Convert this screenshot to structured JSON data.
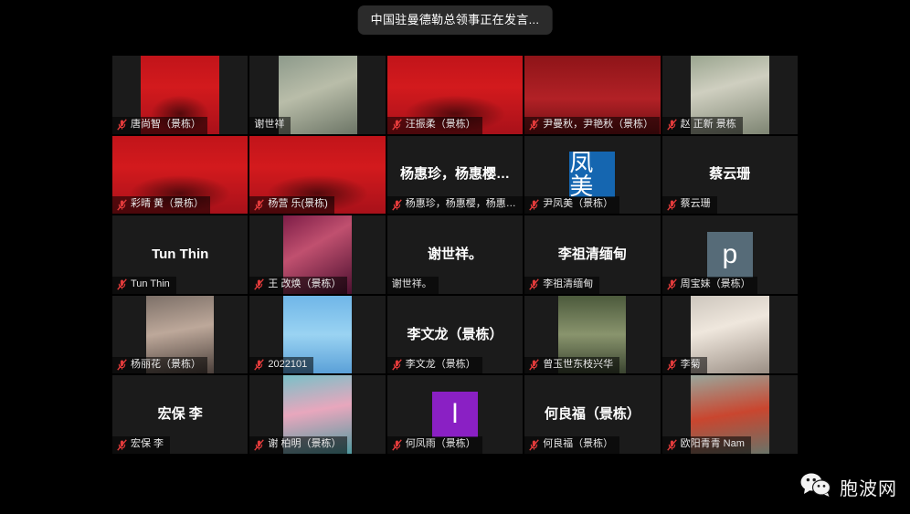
{
  "banner": {
    "speaking_text": "中国驻曼德勒总领事正在发言..."
  },
  "watermark": {
    "icon": "wechat-icon",
    "text": "胞波网"
  },
  "icons": {
    "mic_muted": "mic-muted-icon"
  },
  "gallery": {
    "columns": 5,
    "rows": 5,
    "tiles": [
      {
        "label": "唐尚智（景栋）",
        "muted": true,
        "kind": "photo",
        "style": "bg-red-banner",
        "photo_class": "photo"
      },
      {
        "label": "谢世祥",
        "muted": false,
        "kind": "photo",
        "style": "bg-office",
        "photo_class": "photo"
      },
      {
        "label": "汪振柔（景栋）",
        "muted": true,
        "kind": "photo",
        "style": "bg-red-banner",
        "photo_class": "photo wide"
      },
      {
        "label": "尹曼秋，尹艳秋（景栋）",
        "muted": true,
        "kind": "photo",
        "style": "bg-girls",
        "photo_class": "photo wide"
      },
      {
        "label": "赵 正新  景栋",
        "muted": true,
        "kind": "photo",
        "style": "bg-man",
        "photo_class": "photo"
      },
      {
        "label": "彩晴 黄（景栋）",
        "muted": true,
        "kind": "photo",
        "style": "bg-red-banner",
        "photo_class": "photo wide"
      },
      {
        "label": "杨营 乐(景栋)",
        "muted": true,
        "kind": "photo",
        "style": "bg-red-banner",
        "photo_class": "photo wide"
      },
      {
        "label": "杨惠珍，杨惠樱，杨惠…",
        "muted": true,
        "kind": "name",
        "display_name": "杨惠珍，杨惠樱…"
      },
      {
        "label": "尹凤美（景栋）",
        "muted": true,
        "kind": "avatar",
        "avatar_letter": "凤美",
        "avatar_color": "#1566b0",
        "avatar_font": 26
      },
      {
        "label": "蔡云珊",
        "muted": true,
        "kind": "name",
        "display_name": "蔡云珊"
      },
      {
        "label": "Tun Thin",
        "muted": true,
        "kind": "name",
        "display_name": "Tun Thin"
      },
      {
        "label": "王 改焕（景栋）",
        "muted": true,
        "kind": "photo",
        "style": "bg-party",
        "photo_class": "photo sq"
      },
      {
        "label": "谢世祥。",
        "muted": false,
        "kind": "name",
        "display_name": "谢世祥。"
      },
      {
        "label": "李祖清缅甸",
        "muted": true,
        "kind": "name",
        "display_name": "李祖清缅甸"
      },
      {
        "label": "周宝妹（景栋）",
        "muted": true,
        "kind": "avatar",
        "avatar_letter": "p",
        "avatar_color": "#566b78",
        "avatar_font": 30
      },
      {
        "label": "杨丽花（景栋）",
        "muted": true,
        "kind": "photo",
        "style": "bg-lady",
        "photo_class": "photo sq"
      },
      {
        "label": "2022101",
        "muted": true,
        "kind": "photo",
        "style": "bg-anime",
        "photo_class": "photo sq"
      },
      {
        "label": "李文龙（景栋）",
        "muted": true,
        "kind": "name",
        "display_name": "李文龙（景栋）"
      },
      {
        "label": "曾玉世东枝兴华",
        "muted": true,
        "kind": "photo",
        "style": "bg-path",
        "photo_class": "photo sq"
      },
      {
        "label": "李菊",
        "muted": true,
        "kind": "photo",
        "style": "bg-glasses",
        "photo_class": "photo"
      },
      {
        "label": "宏保 李",
        "muted": true,
        "kind": "name",
        "display_name": "宏保 李"
      },
      {
        "label": "谢 柏明（景栋）",
        "muted": true,
        "kind": "photo",
        "style": "bg-lotus",
        "photo_class": "photo sq"
      },
      {
        "label": "何凤雨（景栋）",
        "muted": true,
        "kind": "avatar",
        "avatar_letter": "l",
        "avatar_color": "#8a20c4",
        "avatar_font": 30
      },
      {
        "label": "何良福（景栋）",
        "muted": true,
        "kind": "name",
        "display_name": "何良福（景栋）"
      },
      {
        "label": "欧阳青青 Nam",
        "muted": true,
        "kind": "photo",
        "style": "bg-red-lady",
        "photo_class": "photo"
      }
    ]
  }
}
